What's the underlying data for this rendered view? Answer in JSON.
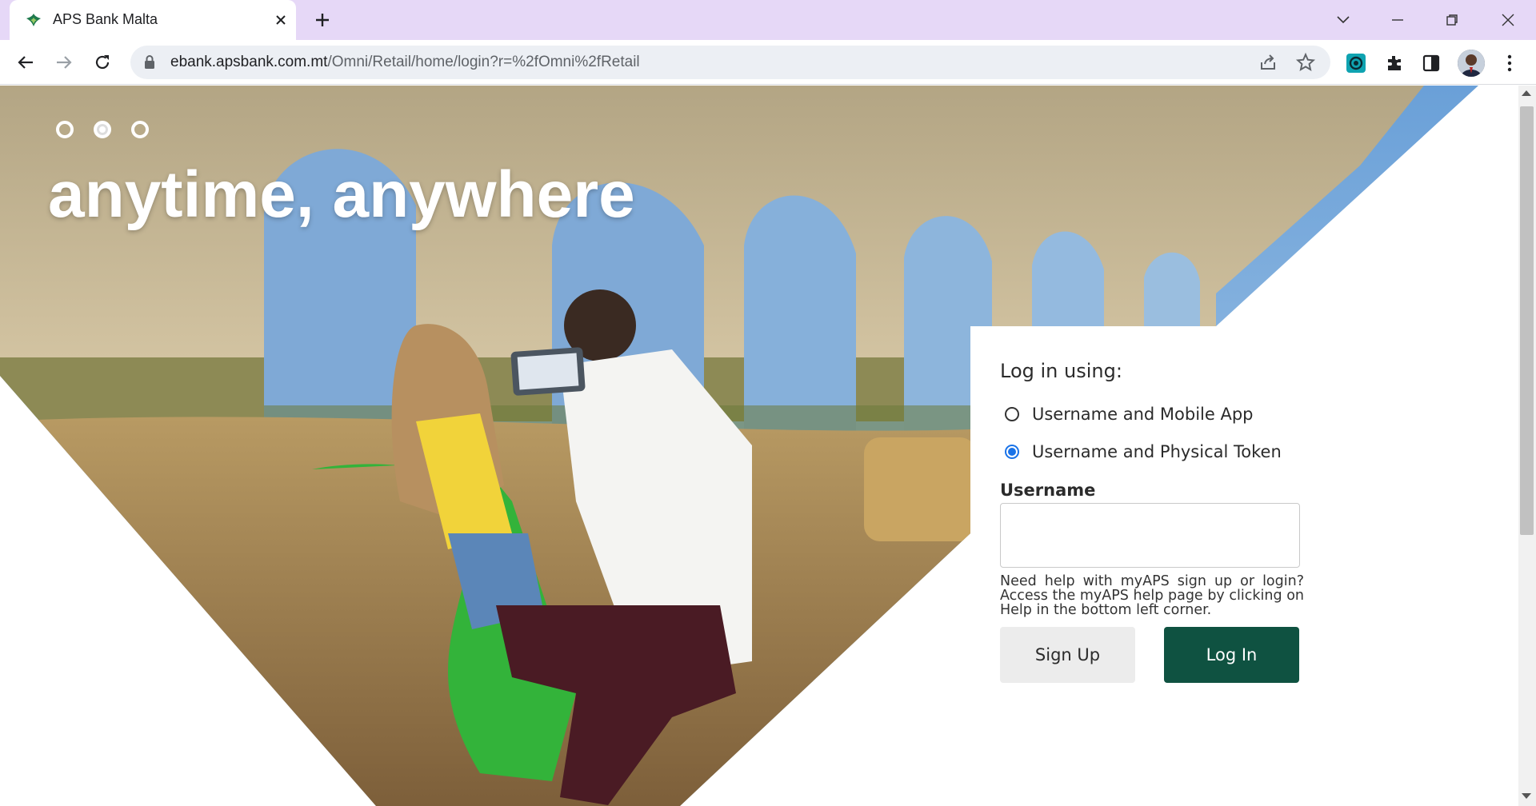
{
  "browser": {
    "tab_title": "APS Bank Malta",
    "url_host": "ebank.apsbank.com.mt",
    "url_path": "/Omni/Retail/home/login?r=%2fOmni%2fRetail"
  },
  "hero": {
    "headline": "anytime, anywhere",
    "carousel_dots": 3,
    "active_dot": 2
  },
  "login": {
    "title": "Log in using:",
    "options": [
      {
        "label": "Username and Mobile App",
        "checked": false
      },
      {
        "label": "Username and Physical Token",
        "checked": true
      }
    ],
    "username_label": "Username",
    "username_value": "",
    "help_text": "Need help with myAPS sign up or login? Access the myAPS help page by clicking on Help in the bottom left corner.",
    "signup_label": "Sign Up",
    "login_label": "Log In"
  },
  "colors": {
    "brand_green": "#0f5241",
    "tabbar": "#e6d8f7",
    "radio_accent": "#1a73e8"
  }
}
